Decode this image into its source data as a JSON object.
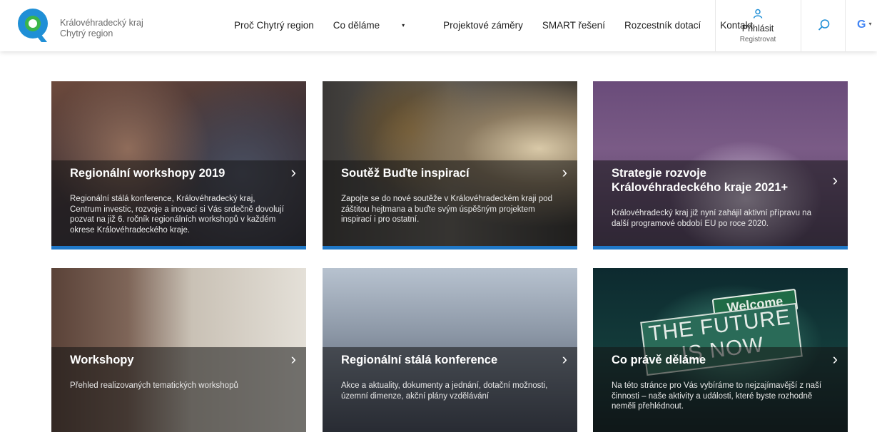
{
  "brand": {
    "line1": "Královéhradecký kraj",
    "line2": "Chytrý region",
    "accent": "#1f8fd6",
    "logo_inner": "#3cb54a"
  },
  "nav": {
    "items": [
      {
        "label": "Proč Chytrý region"
      },
      {
        "label": "Co děláme",
        "caret": "▾"
      },
      {
        "label": "Projektové záměry"
      },
      {
        "label": "SMART řešení"
      },
      {
        "label": "Rozcestník dotací"
      },
      {
        "label": "Kontakt"
      }
    ]
  },
  "account": {
    "login_label": "Přihlásit",
    "register_label": "Registrovat",
    "icon": "user-icon"
  },
  "search": {
    "icon": "search-icon"
  },
  "language": {
    "icon": "google-translate-icon",
    "letter": "G",
    "caret": "▾"
  },
  "cards": [
    {
      "title": "Regionální workshopy 2019",
      "description": "Regionální stálá konference, Královéhradecký kraj, Centrum investic, rozvoje a inovací si Vás srdečně dovolují pozvat na již 6. ročník regionálních workshopů v každém okrese Královéhradeckého kraje."
    },
    {
      "title": "Soutěž Buďte inspirací",
      "description": "Zapojte se do nové soutěže v Královéhradeckém kraji pod záštitou hejtmana a buďte svým úspěšným projektem inspirací i pro ostatní."
    },
    {
      "title": "Strategie rozvoje Královéhradeckého kraje 2021+",
      "description": "Královéhradecký kraj již nyní zahájil aktivní přípravu na další programové období EU po roce 2020."
    },
    {
      "title": "Workshopy",
      "description": "Přehled realizovaných tematických workshopů"
    },
    {
      "title": "Regionální stálá konference",
      "description": "Akce a aktuality, dokumenty a jednání, dotační možnosti, územní dimenze, akční plány vzdělávání"
    },
    {
      "title": "Co právě děláme",
      "description": "Na této stránce pro Vás vybíráme to nejzajímavější z naší činnosti – naše aktivity a události, které byste rozhodně neměli přehlédnout."
    }
  ],
  "card_chevron": "›",
  "card_accent": "#1f78c8",
  "image_sign": {
    "welcome": "Welcome",
    "line1": "THE FUTURE",
    "line2": "IS NOW"
  }
}
